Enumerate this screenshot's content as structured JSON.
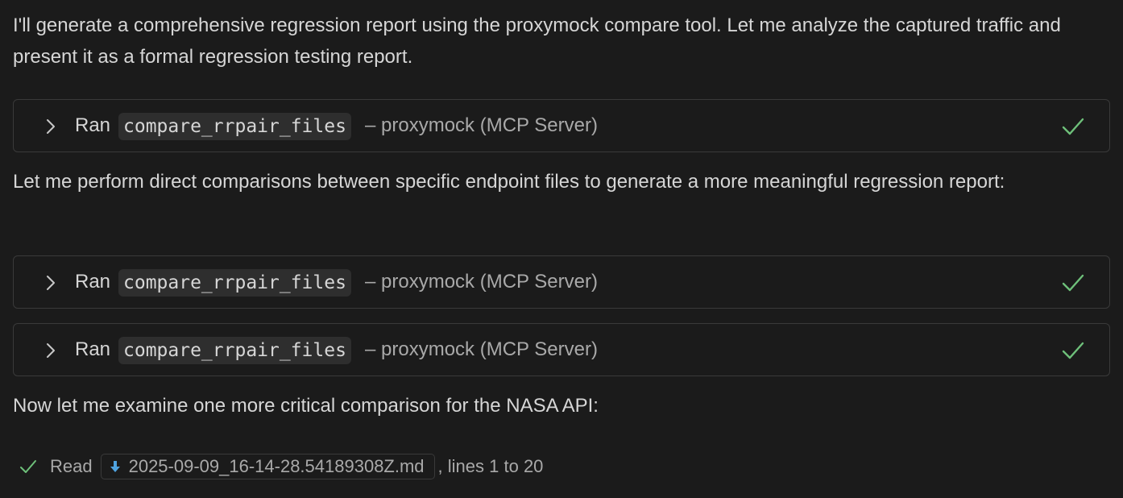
{
  "intro_text": "I'll generate a comprehensive regression report using the proxymock compare tool. Let me analyze the captured traffic and present it as a formal regression testing report.",
  "second_text": "Let me perform direct comparisons between specific endpoint files to generate a more meaningful regression report:",
  "third_text": "Now let me examine one more critical comparison for the NASA API:",
  "tool_calls": [
    {
      "ran_label": "Ran",
      "tool_name": "compare_rrpair_files",
      "server_label": "– proxymock (MCP Server)",
      "status": "success"
    },
    {
      "ran_label": "Ran",
      "tool_name": "compare_rrpair_files",
      "server_label": "– proxymock (MCP Server)",
      "status": "success"
    },
    {
      "ran_label": "Ran",
      "tool_name": "compare_rrpair_files",
      "server_label": "– proxymock (MCP Server)",
      "status": "success"
    }
  ],
  "read_item": {
    "label": "Read",
    "file_name": "2025-09-09_16-14-28.54189308Z.md",
    "suffix": ", lines 1 to 20"
  },
  "colors": {
    "background": "#1b1b1b",
    "success_check": "#6ec07a",
    "file_icon": "#4fa3e0",
    "border": "#3a3a3a"
  },
  "icons": {
    "expand": "chevron-right-icon",
    "status": "checkmark-icon",
    "file": "download-arrow-icon"
  }
}
